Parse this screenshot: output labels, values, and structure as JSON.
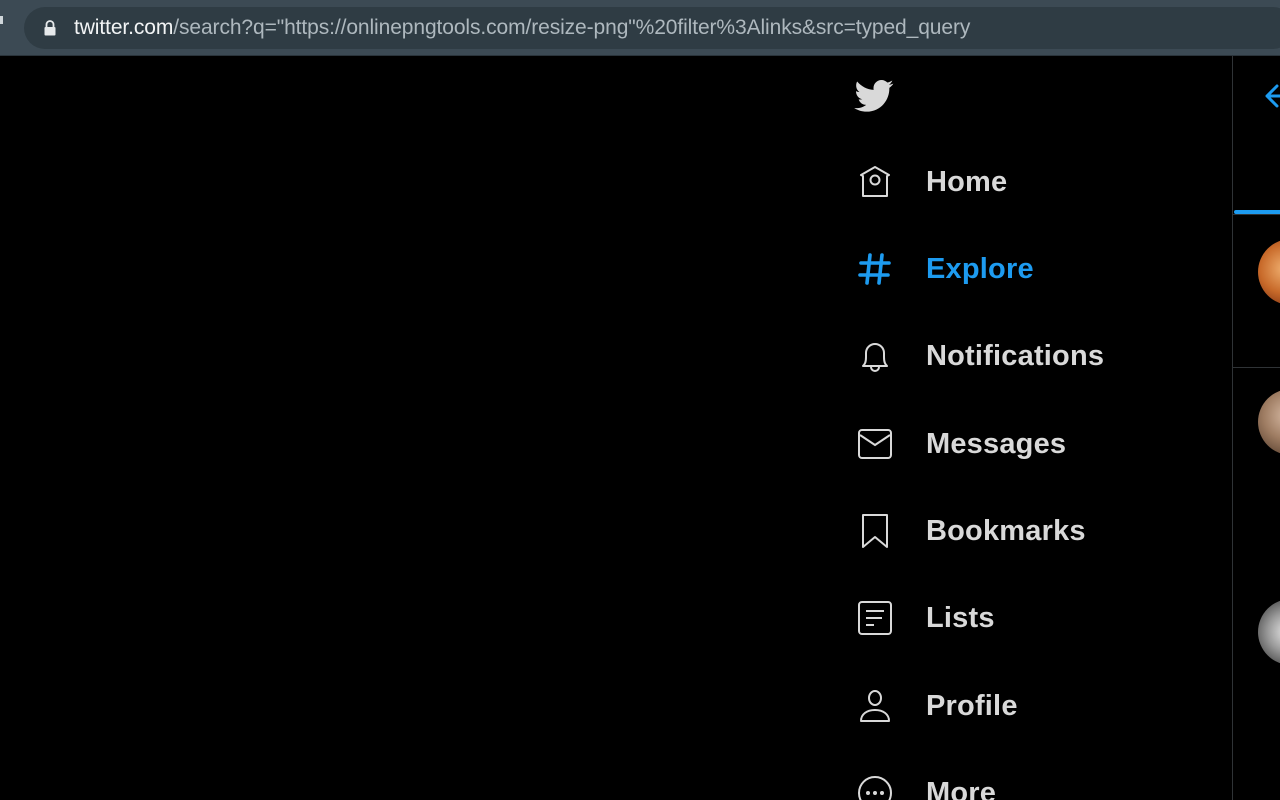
{
  "browser": {
    "url_host": "twitter.com",
    "url_path": "/search?q=\"https://onlinepngtools.com/resize-png\"%20filter%3Alinks&src=typed_query",
    "lock_icon": "lock-icon"
  },
  "sidebar": {
    "logo_icon": "twitter-bird-icon",
    "items": [
      {
        "label": "Home",
        "icon": "home-icon",
        "active": false
      },
      {
        "label": "Explore",
        "icon": "hashtag-icon",
        "active": true
      },
      {
        "label": "Notifications",
        "icon": "bell-icon",
        "active": false
      },
      {
        "label": "Messages",
        "icon": "envelope-icon",
        "active": false
      },
      {
        "label": "Bookmarks",
        "icon": "bookmark-icon",
        "active": false
      },
      {
        "label": "Lists",
        "icon": "list-icon",
        "active": false
      },
      {
        "label": "Profile",
        "icon": "person-icon",
        "active": false
      },
      {
        "label": "More",
        "icon": "more-circle-icon",
        "active": false
      }
    ]
  },
  "main": {
    "back_icon": "back-arrow-icon"
  },
  "colors": {
    "accent": "#1d9bf0",
    "text": "#d9d9d9",
    "background": "#000000",
    "chrome": "#3c4a54",
    "omnibox": "#2f3c44"
  }
}
